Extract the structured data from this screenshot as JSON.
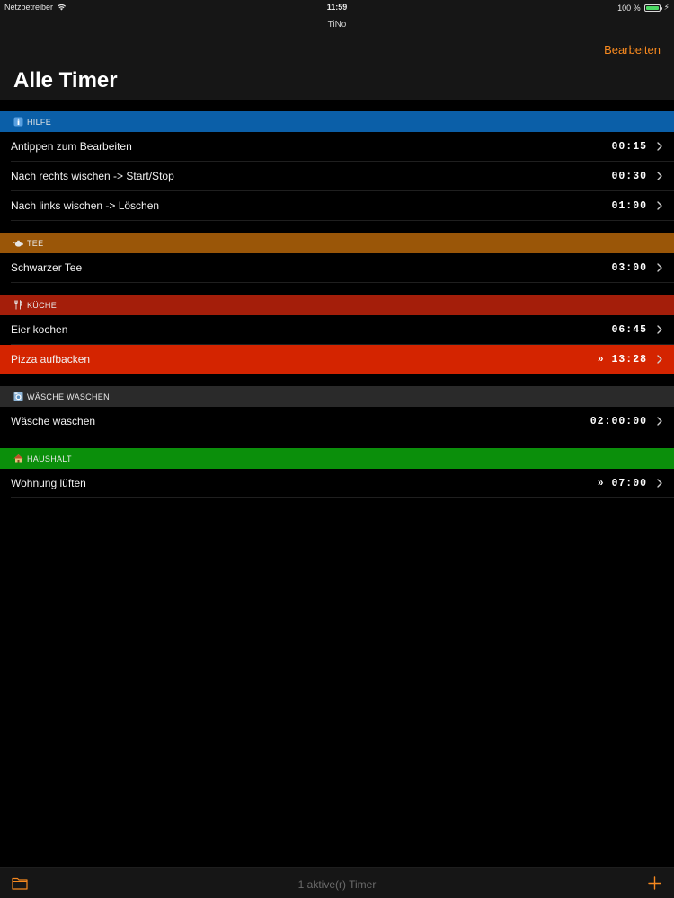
{
  "status_bar": {
    "carrier": "Netzbetreiber",
    "time": "11:59",
    "battery": "100 %",
    "battery_level": 1.0
  },
  "nav": {
    "app_name": "TiNo",
    "edit_label": "Bearbeiten",
    "title": "Alle Timer",
    "accent_color": "#f7891f"
  },
  "sections": [
    {
      "title": "HILFE",
      "icon": "info-icon",
      "color": "#0b5fa8",
      "rows": [
        {
          "label": "Antippen zum Bearbeiten",
          "time": "00:15",
          "active": false
        },
        {
          "label": "Nach rechts wischen -> Start/Stop",
          "time": "00:30",
          "active": false
        },
        {
          "label": "Nach links wischen -> Löschen",
          "time": "01:00",
          "active": false
        }
      ]
    },
    {
      "title": "TEE",
      "icon": "teapot-icon",
      "color": "#9a5608",
      "rows": [
        {
          "label": "Schwarzer Tee",
          "time": "03:00",
          "active": false
        }
      ]
    },
    {
      "title": "KÜCHE",
      "icon": "fork-knife-icon",
      "color": "#a41e0a",
      "rows": [
        {
          "label": "Eier kochen",
          "time": "06:45",
          "active": false
        },
        {
          "label": "Pizza aufbacken",
          "time": "» 13:28",
          "active": true
        }
      ]
    },
    {
      "title": "WÄSCHE WASCHEN",
      "icon": "laundry-icon",
      "color": "#2a2a2a",
      "rows": [
        {
          "label": "Wäsche waschen",
          "time": "02:00:00",
          "active": false
        }
      ]
    },
    {
      "title": "HAUSHALT",
      "icon": "house-icon",
      "color": "#0b8f0b",
      "rows": [
        {
          "label": "Wohnung lüften",
          "time": "» 07:00",
          "active": false
        }
      ]
    }
  ],
  "toolbar": {
    "status": "1 aktive(r) Timer",
    "folder_icon": "folder-icon",
    "add_icon": "plus-icon"
  }
}
